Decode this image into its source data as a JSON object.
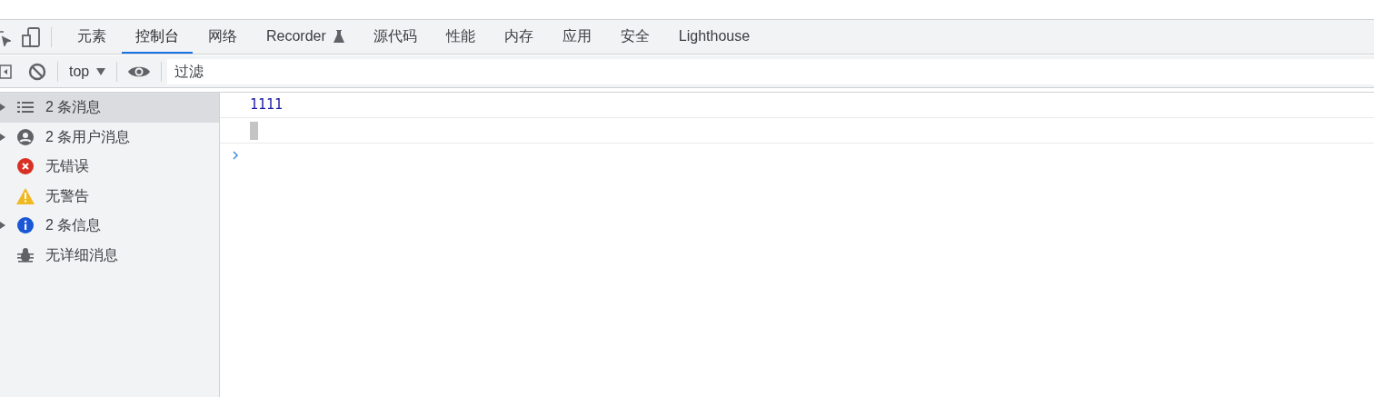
{
  "tabs": [
    {
      "label": "元素",
      "selected": false,
      "badge": false
    },
    {
      "label": "控制台",
      "selected": true,
      "badge": false
    },
    {
      "label": "网络",
      "selected": false,
      "badge": false
    },
    {
      "label": "Recorder",
      "selected": false,
      "badge": true
    },
    {
      "label": "源代码",
      "selected": false,
      "badge": false
    },
    {
      "label": "性能",
      "selected": false,
      "badge": false
    },
    {
      "label": "内存",
      "selected": false,
      "badge": false
    },
    {
      "label": "应用",
      "selected": false,
      "badge": false
    },
    {
      "label": "安全",
      "selected": false,
      "badge": false
    },
    {
      "label": "Lighthouse",
      "selected": false,
      "badge": false
    }
  ],
  "toolbar": {
    "context": "top",
    "filter": {
      "placeholder": "过滤"
    }
  },
  "sidebar": {
    "items": [
      {
        "kind": "messages",
        "label": "2 条消息",
        "expandable": true,
        "selected": true
      },
      {
        "kind": "user",
        "label": "2 条用户消息",
        "expandable": true,
        "selected": false
      },
      {
        "kind": "error",
        "label": "无错误",
        "expandable": false,
        "selected": false
      },
      {
        "kind": "warning",
        "label": "无警告",
        "expandable": false,
        "selected": false
      },
      {
        "kind": "info",
        "label": "2 条信息",
        "expandable": true,
        "selected": false
      },
      {
        "kind": "verbose",
        "label": "无详细消息",
        "expandable": false,
        "selected": false
      }
    ]
  },
  "console": {
    "messages": [
      {
        "kind": "log",
        "text": "1111"
      },
      {
        "kind": "blank"
      }
    ]
  }
}
